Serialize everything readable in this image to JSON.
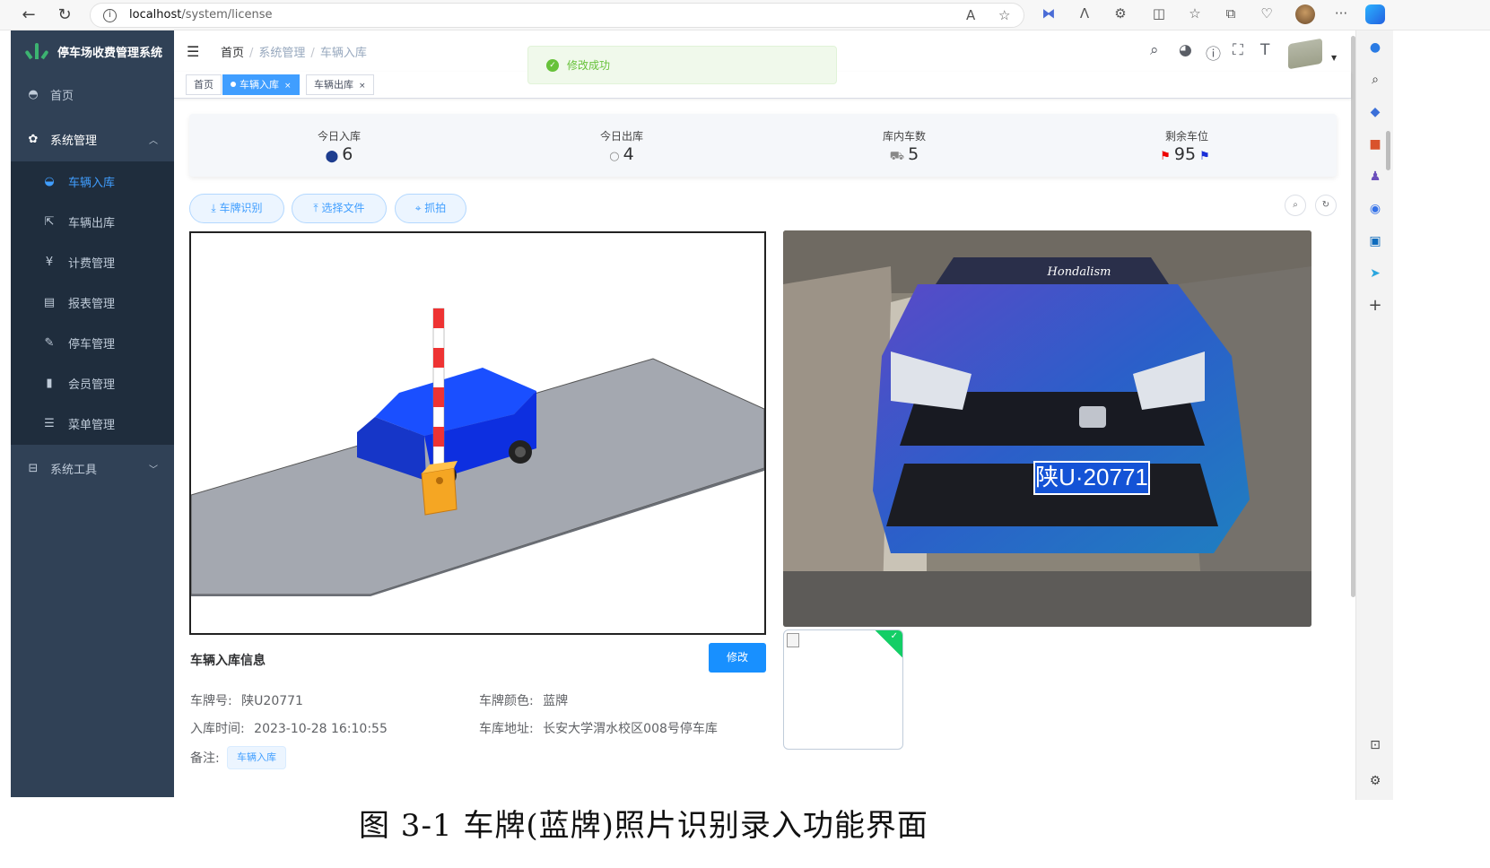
{
  "browser": {
    "url_host": "localhost",
    "url_path": "/system/license"
  },
  "app": {
    "title": "停车场收费管理系统"
  },
  "sidebar": {
    "home": "首页",
    "system_mgmt": "系统管理",
    "system_tools": "系统工具",
    "sub_items": [
      {
        "label": "车辆入库",
        "icon": "github-icon"
      },
      {
        "label": "车辆出库",
        "icon": "exit-icon"
      },
      {
        "label": "计费管理",
        "icon": "yen-icon"
      },
      {
        "label": "报表管理",
        "icon": "report-icon"
      },
      {
        "label": "停车管理",
        "icon": "edit-icon"
      },
      {
        "label": "会员管理",
        "icon": "book-icon"
      },
      {
        "label": "菜单管理",
        "icon": "list-icon"
      }
    ]
  },
  "breadcrumb": {
    "home": "首页",
    "level1": "系统管理",
    "level2": "车辆入库"
  },
  "tags": {
    "home": "首页",
    "active": "车辆入库",
    "other": "车辆出库",
    "close": "×"
  },
  "toast": {
    "message": "修改成功"
  },
  "stats": [
    {
      "label": "今日入库",
      "value": "6",
      "icon": "location-icon"
    },
    {
      "label": "今日出库",
      "value": "4",
      "icon": "location-outline-icon"
    },
    {
      "label": "库内车数",
      "value": "5",
      "icon": "truck-icon"
    },
    {
      "label": "剩余车位",
      "value": "95",
      "icon": "flag-icon"
    }
  ],
  "actions": {
    "recognize": "车牌识别",
    "select_file": "选择文件",
    "capture": "抓拍"
  },
  "photo": {
    "plate_text": "陕U·20771",
    "brand_sticker": "Hondalism"
  },
  "info": {
    "title": "车辆入库信息",
    "edit": "修改",
    "plate_label": "车牌号:",
    "plate_value": "陕U20771",
    "color_label": "车牌颜色:",
    "color_value": "蓝牌",
    "time_label": "入库时间:",
    "time_value": "2023-10-28 16:10:55",
    "address_label": "车库地址:",
    "address_value": "长安大学渭水校区008号停车库",
    "remark_label": "备注:",
    "remark_value": "车辆入库"
  },
  "caption": "图 3-1 车牌(蓝牌)照片识别录入功能界面",
  "colors": {
    "sidebar_bg": "#304156",
    "submenu_bg": "#1f2d3d",
    "primary": "#409eff",
    "success": "#67c23a"
  }
}
